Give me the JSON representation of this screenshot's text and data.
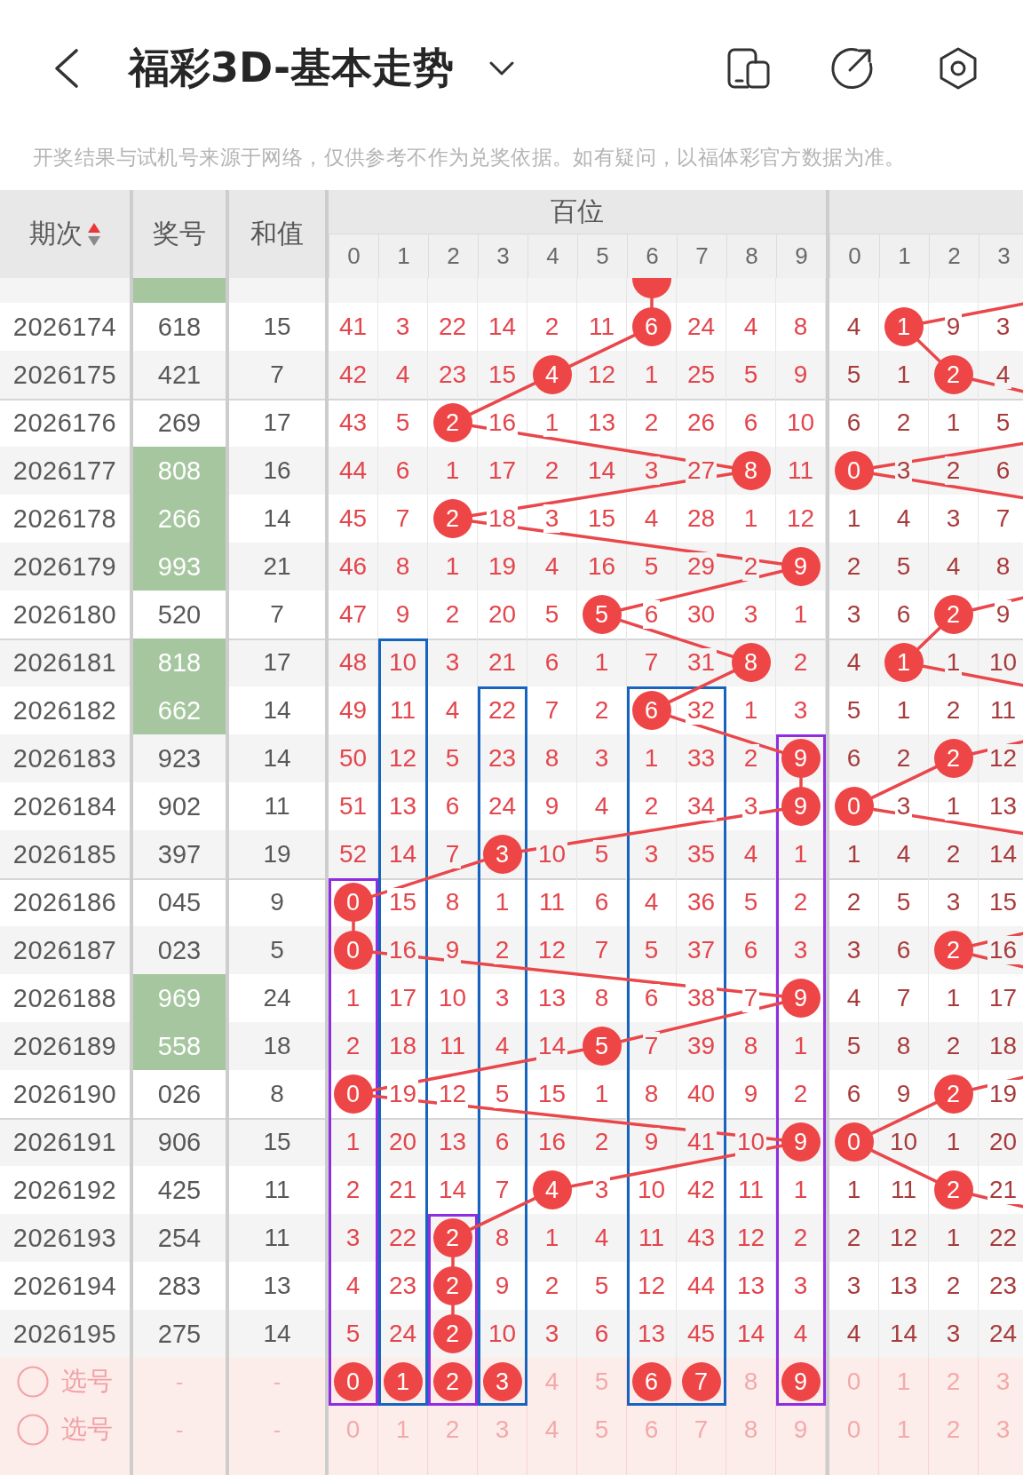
{
  "top_bar": {
    "title": "福彩3D-基本走势"
  },
  "notice": "开奖结果与试机号来源于网络，仅供参考不作为兑奖依据。如有疑问，以福体彩官方数据为准。",
  "table": {
    "issue_header": "期次",
    "sort_ascending": true,
    "number_header": "奖号",
    "sum_header": "和值",
    "hundreds_header": {
      "label": "百位",
      "digits": [
        "0",
        "1",
        "2",
        "3",
        "4",
        "5",
        "6",
        "7",
        "8",
        "9"
      ]
    },
    "group_2_header": {
      "digits": [
        "0",
        "1",
        "2",
        "3"
      ]
    },
    "cut_row": {
      "highlighted": true,
      "hundreds": [
        {
          "hit": false
        },
        {
          "hit": false
        },
        {
          "hit": false
        },
        {
          "hit": false
        },
        {
          "hit": false
        },
        {
          "hit": false
        },
        {
          "hit": true
        },
        {
          "hit": false
        },
        {
          "hit": false
        },
        {
          "hit": false
        }
      ]
    },
    "rows": [
      {
        "issue": "2026174",
        "number": "618",
        "sum": "15",
        "highlighted": false,
        "hundreds": [
          {
            "value": "41",
            "hit": false
          },
          {
            "value": "3",
            "hit": false
          },
          {
            "value": "22",
            "hit": false
          },
          {
            "value": "14",
            "hit": false
          },
          {
            "value": "2",
            "hit": false
          },
          {
            "value": "11",
            "hit": false
          },
          {
            "value": "6",
            "hit": true
          },
          {
            "value": "24",
            "hit": false
          },
          {
            "value": "4",
            "hit": false
          },
          {
            "value": "8",
            "hit": false
          }
        ],
        "group_2": [
          {
            "value": "4",
            "hit": false
          },
          {
            "value": "1",
            "hit": true
          },
          {
            "value": "9",
            "hit": false
          },
          {
            "value": "3",
            "hit": false
          }
        ]
      },
      {
        "issue": "2026175",
        "number": "421",
        "sum": "7",
        "highlighted": false,
        "hundreds": [
          {
            "value": "42",
            "hit": false
          },
          {
            "value": "4",
            "hit": false
          },
          {
            "value": "23",
            "hit": false
          },
          {
            "value": "15",
            "hit": false
          },
          {
            "value": "4",
            "hit": true
          },
          {
            "value": "12",
            "hit": false
          },
          {
            "value": "1",
            "hit": false
          },
          {
            "value": "25",
            "hit": false
          },
          {
            "value": "5",
            "hit": false
          },
          {
            "value": "9",
            "hit": false
          }
        ],
        "group_2": [
          {
            "value": "5",
            "hit": false
          },
          {
            "value": "1",
            "hit": false
          },
          {
            "value": "2",
            "hit": true
          },
          {
            "value": "4",
            "hit": false
          }
        ]
      },
      {
        "issue": "2026176",
        "number": "269",
        "sum": "17",
        "highlighted": false,
        "hundreds": [
          {
            "value": "43",
            "hit": false
          },
          {
            "value": "5",
            "hit": false
          },
          {
            "value": "2",
            "hit": true
          },
          {
            "value": "16",
            "hit": false
          },
          {
            "value": "1",
            "hit": false
          },
          {
            "value": "13",
            "hit": false
          },
          {
            "value": "2",
            "hit": false
          },
          {
            "value": "26",
            "hit": false
          },
          {
            "value": "6",
            "hit": false
          },
          {
            "value": "10",
            "hit": false
          }
        ],
        "group_2": [
          {
            "value": "6",
            "hit": false
          },
          {
            "value": "2",
            "hit": false
          },
          {
            "value": "1",
            "hit": false
          },
          {
            "value": "5",
            "hit": false
          }
        ]
      },
      {
        "issue": "2026177",
        "number": "808",
        "sum": "16",
        "highlighted": true,
        "hundreds": [
          {
            "value": "44",
            "hit": false
          },
          {
            "value": "6",
            "hit": false
          },
          {
            "value": "1",
            "hit": false
          },
          {
            "value": "17",
            "hit": false
          },
          {
            "value": "2",
            "hit": false
          },
          {
            "value": "14",
            "hit": false
          },
          {
            "value": "3",
            "hit": false
          },
          {
            "value": "27",
            "hit": false
          },
          {
            "value": "8",
            "hit": true
          },
          {
            "value": "11",
            "hit": false
          }
        ],
        "group_2": [
          {
            "value": "0",
            "hit": true
          },
          {
            "value": "3",
            "hit": false
          },
          {
            "value": "2",
            "hit": false
          },
          {
            "value": "6",
            "hit": false
          }
        ]
      },
      {
        "issue": "2026178",
        "number": "266",
        "sum": "14",
        "highlighted": true,
        "hundreds": [
          {
            "value": "45",
            "hit": false
          },
          {
            "value": "7",
            "hit": false
          },
          {
            "value": "2",
            "hit": true
          },
          {
            "value": "18",
            "hit": false
          },
          {
            "value": "3",
            "hit": false
          },
          {
            "value": "15",
            "hit": false
          },
          {
            "value": "4",
            "hit": false
          },
          {
            "value": "28",
            "hit": false
          },
          {
            "value": "1",
            "hit": false
          },
          {
            "value": "12",
            "hit": false
          }
        ],
        "group_2": [
          {
            "value": "1",
            "hit": false
          },
          {
            "value": "4",
            "hit": false
          },
          {
            "value": "3",
            "hit": false
          },
          {
            "value": "7",
            "hit": false
          }
        ]
      },
      {
        "issue": "2026179",
        "number": "993",
        "sum": "21",
        "highlighted": true,
        "hundreds": [
          {
            "value": "46",
            "hit": false
          },
          {
            "value": "8",
            "hit": false
          },
          {
            "value": "1",
            "hit": false
          },
          {
            "value": "19",
            "hit": false
          },
          {
            "value": "4",
            "hit": false
          },
          {
            "value": "16",
            "hit": false
          },
          {
            "value": "5",
            "hit": false
          },
          {
            "value": "29",
            "hit": false
          },
          {
            "value": "2",
            "hit": false
          },
          {
            "value": "9",
            "hit": true
          }
        ],
        "group_2": [
          {
            "value": "2",
            "hit": false
          },
          {
            "value": "5",
            "hit": false
          },
          {
            "value": "4",
            "hit": false
          },
          {
            "value": "8",
            "hit": false
          }
        ]
      },
      {
        "issue": "2026180",
        "number": "520",
        "sum": "7",
        "highlighted": false,
        "hundreds": [
          {
            "value": "47",
            "hit": false
          },
          {
            "value": "9",
            "hit": false
          },
          {
            "value": "2",
            "hit": false
          },
          {
            "value": "20",
            "hit": false
          },
          {
            "value": "5",
            "hit": false
          },
          {
            "value": "5",
            "hit": true
          },
          {
            "value": "6",
            "hit": false
          },
          {
            "value": "30",
            "hit": false
          },
          {
            "value": "3",
            "hit": false
          },
          {
            "value": "1",
            "hit": false
          }
        ],
        "group_2": [
          {
            "value": "3",
            "hit": false
          },
          {
            "value": "6",
            "hit": false
          },
          {
            "value": "2",
            "hit": true
          },
          {
            "value": "9",
            "hit": false
          }
        ]
      },
      {
        "issue": "2026181",
        "number": "818",
        "sum": "17",
        "highlighted": true,
        "hundreds": [
          {
            "value": "48",
            "hit": false
          },
          {
            "value": "10",
            "hit": false,
            "color": "#1565c0"
          },
          {
            "value": "3",
            "hit": false
          },
          {
            "value": "21",
            "hit": false
          },
          {
            "value": "6",
            "hit": false
          },
          {
            "value": "1",
            "hit": false
          },
          {
            "value": "7",
            "hit": false
          },
          {
            "value": "31",
            "hit": false
          },
          {
            "value": "8",
            "hit": true
          },
          {
            "value": "2",
            "hit": false
          }
        ],
        "group_2": [
          {
            "value": "4",
            "hit": false
          },
          {
            "value": "1",
            "hit": true
          },
          {
            "value": "1",
            "hit": false
          },
          {
            "value": "10",
            "hit": false
          }
        ]
      },
      {
        "issue": "2026182",
        "number": "662",
        "sum": "14",
        "highlighted": true,
        "hundreds": [
          {
            "value": "49",
            "hit": false
          },
          {
            "value": "11",
            "hit": false
          },
          {
            "value": "4",
            "hit": false
          },
          {
            "value": "22",
            "hit": false,
            "color": "#1565c0"
          },
          {
            "value": "7",
            "hit": false
          },
          {
            "value": "2",
            "hit": false
          },
          {
            "value": "6",
            "hit": true,
            "color": "#1565c0"
          },
          {
            "value": "32",
            "hit": false,
            "color": "#1565c0"
          },
          {
            "value": "1",
            "hit": false
          },
          {
            "value": "3",
            "hit": false
          }
        ],
        "group_2": [
          {
            "value": "5",
            "hit": false
          },
          {
            "value": "1",
            "hit": false
          },
          {
            "value": "2",
            "hit": false
          },
          {
            "value": "11",
            "hit": false
          }
        ]
      },
      {
        "issue": "2026183",
        "number": "923",
        "sum": "14",
        "highlighted": false,
        "hundreds": [
          {
            "value": "50",
            "hit": false
          },
          {
            "value": "12",
            "hit": false
          },
          {
            "value": "5",
            "hit": false
          },
          {
            "value": "23",
            "hit": false
          },
          {
            "value": "8",
            "hit": false
          },
          {
            "value": "3",
            "hit": false
          },
          {
            "value": "1",
            "hit": false
          },
          {
            "value": "33",
            "hit": false
          },
          {
            "value": "2",
            "hit": false
          },
          {
            "value": "9",
            "hit": true,
            "color": "#8e2de2"
          }
        ],
        "group_2": [
          {
            "value": "6",
            "hit": false
          },
          {
            "value": "2",
            "hit": false
          },
          {
            "value": "2",
            "hit": true
          },
          {
            "value": "12",
            "hit": false
          }
        ]
      },
      {
        "issue": "2026184",
        "number": "902",
        "sum": "11",
        "highlighted": false,
        "hundreds": [
          {
            "value": "51",
            "hit": false
          },
          {
            "value": "13",
            "hit": false
          },
          {
            "value": "6",
            "hit": false
          },
          {
            "value": "24",
            "hit": false
          },
          {
            "value": "9",
            "hit": false
          },
          {
            "value": "4",
            "hit": false
          },
          {
            "value": "2",
            "hit": false
          },
          {
            "value": "34",
            "hit": false
          },
          {
            "value": "3",
            "hit": false
          },
          {
            "value": "9",
            "hit": true
          }
        ],
        "group_2": [
          {
            "value": "0",
            "hit": true
          },
          {
            "value": "3",
            "hit": false
          },
          {
            "value": "1",
            "hit": false
          },
          {
            "value": "13",
            "hit": false
          }
        ]
      },
      {
        "issue": "2026185",
        "number": "397",
        "sum": "19",
        "highlighted": false,
        "hundreds": [
          {
            "value": "52",
            "hit": false
          },
          {
            "value": "14",
            "hit": false
          },
          {
            "value": "7",
            "hit": false
          },
          {
            "value": "3",
            "hit": true
          },
          {
            "value": "10",
            "hit": false
          },
          {
            "value": "5",
            "hit": false
          },
          {
            "value": "3",
            "hit": false
          },
          {
            "value": "35",
            "hit": false
          },
          {
            "value": "4",
            "hit": false
          },
          {
            "value": "1",
            "hit": false
          }
        ],
        "group_2": [
          {
            "value": "1",
            "hit": false
          },
          {
            "value": "4",
            "hit": false
          },
          {
            "value": "2",
            "hit": false
          },
          {
            "value": "14",
            "hit": false
          }
        ]
      },
      {
        "issue": "2026186",
        "number": "045",
        "sum": "9",
        "highlighted": false,
        "hundreds": [
          {
            "value": "0",
            "hit": true,
            "color": "#8e2de2"
          },
          {
            "value": "15",
            "hit": false
          },
          {
            "value": "8",
            "hit": false
          },
          {
            "value": "1",
            "hit": false
          },
          {
            "value": "11",
            "hit": false
          },
          {
            "value": "6",
            "hit": false
          },
          {
            "value": "4",
            "hit": false
          },
          {
            "value": "36",
            "hit": false
          },
          {
            "value": "5",
            "hit": false
          },
          {
            "value": "2",
            "hit": false
          }
        ],
        "group_2": [
          {
            "value": "2",
            "hit": false
          },
          {
            "value": "5",
            "hit": false
          },
          {
            "value": "3",
            "hit": false
          },
          {
            "value": "15",
            "hit": false
          }
        ]
      },
      {
        "issue": "2026187",
        "number": "023",
        "sum": "5",
        "highlighted": false,
        "hundreds": [
          {
            "value": "0",
            "hit": true
          },
          {
            "value": "16",
            "hit": false
          },
          {
            "value": "9",
            "hit": false
          },
          {
            "value": "2",
            "hit": false
          },
          {
            "value": "12",
            "hit": false
          },
          {
            "value": "7",
            "hit": false
          },
          {
            "value": "5",
            "hit": false
          },
          {
            "value": "37",
            "hit": false
          },
          {
            "value": "6",
            "hit": false
          },
          {
            "value": "3",
            "hit": false
          }
        ],
        "group_2": [
          {
            "value": "3",
            "hit": false
          },
          {
            "value": "6",
            "hit": false
          },
          {
            "value": "2",
            "hit": true
          },
          {
            "value": "16",
            "hit": false
          }
        ]
      },
      {
        "issue": "2026188",
        "number": "969",
        "sum": "24",
        "highlighted": true,
        "hundreds": [
          {
            "value": "1",
            "hit": false
          },
          {
            "value": "17",
            "hit": false
          },
          {
            "value": "10",
            "hit": false
          },
          {
            "value": "3",
            "hit": false
          },
          {
            "value": "13",
            "hit": false
          },
          {
            "value": "8",
            "hit": false
          },
          {
            "value": "6",
            "hit": false
          },
          {
            "value": "38",
            "hit": false
          },
          {
            "value": "7",
            "hit": false
          },
          {
            "value": "9",
            "hit": true
          }
        ],
        "group_2": [
          {
            "value": "4",
            "hit": false
          },
          {
            "value": "7",
            "hit": false
          },
          {
            "value": "1",
            "hit": false
          },
          {
            "value": "17",
            "hit": false
          }
        ]
      },
      {
        "issue": "2026189",
        "number": "558",
        "sum": "18",
        "highlighted": true,
        "hundreds": [
          {
            "value": "2",
            "hit": false
          },
          {
            "value": "18",
            "hit": false
          },
          {
            "value": "11",
            "hit": false
          },
          {
            "value": "4",
            "hit": false
          },
          {
            "value": "14",
            "hit": false
          },
          {
            "value": "5",
            "hit": true
          },
          {
            "value": "7",
            "hit": false
          },
          {
            "value": "39",
            "hit": false
          },
          {
            "value": "8",
            "hit": false
          },
          {
            "value": "1",
            "hit": false
          }
        ],
        "group_2": [
          {
            "value": "5",
            "hit": false
          },
          {
            "value": "8",
            "hit": false
          },
          {
            "value": "2",
            "hit": false
          },
          {
            "value": "18",
            "hit": false
          }
        ]
      },
      {
        "issue": "2026190",
        "number": "026",
        "sum": "8",
        "highlighted": false,
        "hundreds": [
          {
            "value": "0",
            "hit": true
          },
          {
            "value": "19",
            "hit": false
          },
          {
            "value": "12",
            "hit": false
          },
          {
            "value": "5",
            "hit": false
          },
          {
            "value": "15",
            "hit": false
          },
          {
            "value": "1",
            "hit": false
          },
          {
            "value": "8",
            "hit": false
          },
          {
            "value": "40",
            "hit": false
          },
          {
            "value": "9",
            "hit": false
          },
          {
            "value": "2",
            "hit": false
          }
        ],
        "group_2": [
          {
            "value": "6",
            "hit": false
          },
          {
            "value": "9",
            "hit": false
          },
          {
            "value": "2",
            "hit": true
          },
          {
            "value": "19",
            "hit": false
          }
        ]
      },
      {
        "issue": "2026191",
        "number": "906",
        "sum": "15",
        "highlighted": false,
        "hundreds": [
          {
            "value": "1",
            "hit": false
          },
          {
            "value": "20",
            "hit": false
          },
          {
            "value": "13",
            "hit": false
          },
          {
            "value": "6",
            "hit": false
          },
          {
            "value": "16",
            "hit": false
          },
          {
            "value": "2",
            "hit": false
          },
          {
            "value": "9",
            "hit": false
          },
          {
            "value": "41",
            "hit": false
          },
          {
            "value": "10",
            "hit": false
          },
          {
            "value": "9",
            "hit": true
          }
        ],
        "group_2": [
          {
            "value": "0",
            "hit": true
          },
          {
            "value": "10",
            "hit": false
          },
          {
            "value": "1",
            "hit": false
          },
          {
            "value": "20",
            "hit": false
          }
        ]
      },
      {
        "issue": "2026192",
        "number": "425",
        "sum": "11",
        "highlighted": false,
        "hundreds": [
          {
            "value": "2",
            "hit": false
          },
          {
            "value": "21",
            "hit": false
          },
          {
            "value": "14",
            "hit": false
          },
          {
            "value": "7",
            "hit": false
          },
          {
            "value": "4",
            "hit": true
          },
          {
            "value": "3",
            "hit": false
          },
          {
            "value": "10",
            "hit": false
          },
          {
            "value": "42",
            "hit": false
          },
          {
            "value": "11",
            "hit": false
          },
          {
            "value": "1",
            "hit": false
          }
        ],
        "group_2": [
          {
            "value": "1",
            "hit": false
          },
          {
            "value": "11",
            "hit": false
          },
          {
            "value": "2",
            "hit": true
          },
          {
            "value": "21",
            "hit": false
          }
        ]
      },
      {
        "issue": "2026193",
        "number": "254",
        "sum": "11",
        "highlighted": false,
        "hundreds": [
          {
            "value": "3",
            "hit": false
          },
          {
            "value": "22",
            "hit": false
          },
          {
            "value": "2",
            "hit": true,
            "color": "#8e2de2"
          },
          {
            "value": "8",
            "hit": false
          },
          {
            "value": "1",
            "hit": false
          },
          {
            "value": "4",
            "hit": false
          },
          {
            "value": "11",
            "hit": false
          },
          {
            "value": "43",
            "hit": false
          },
          {
            "value": "12",
            "hit": false
          },
          {
            "value": "2",
            "hit": false
          }
        ],
        "group_2": [
          {
            "value": "2",
            "hit": false
          },
          {
            "value": "12",
            "hit": false
          },
          {
            "value": "1",
            "hit": false
          },
          {
            "value": "22",
            "hit": false
          }
        ]
      },
      {
        "issue": "2026194",
        "number": "283",
        "sum": "13",
        "highlighted": false,
        "hundreds": [
          {
            "value": "4",
            "hit": false
          },
          {
            "value": "23",
            "hit": false
          },
          {
            "value": "2",
            "hit": true
          },
          {
            "value": "9",
            "hit": false
          },
          {
            "value": "2",
            "hit": false
          },
          {
            "value": "5",
            "hit": false
          },
          {
            "value": "12",
            "hit": false
          },
          {
            "value": "44",
            "hit": false
          },
          {
            "value": "13",
            "hit": false
          },
          {
            "value": "3",
            "hit": false
          }
        ],
        "group_2": [
          {
            "value": "3",
            "hit": false
          },
          {
            "value": "13",
            "hit": false
          },
          {
            "value": "2",
            "hit": false
          },
          {
            "value": "23",
            "hit": false
          }
        ]
      },
      {
        "issue": "2026195",
        "number": "275",
        "sum": "14",
        "highlighted": false,
        "hundreds": [
          {
            "value": "5",
            "hit": false
          },
          {
            "value": "24",
            "hit": false
          },
          {
            "value": "2",
            "hit": true
          },
          {
            "value": "10",
            "hit": false
          },
          {
            "value": "3",
            "hit": false
          },
          {
            "value": "6",
            "hit": false
          },
          {
            "value": "13",
            "hit": false
          },
          {
            "value": "45",
            "hit": false
          },
          {
            "value": "14",
            "hit": false
          },
          {
            "value": "4",
            "hit": false
          }
        ],
        "group_2": [
          {
            "value": "4",
            "hit": false
          },
          {
            "value": "14",
            "hit": false
          },
          {
            "value": "3",
            "hit": false
          },
          {
            "value": "24",
            "hit": false
          }
        ]
      }
    ],
    "pick_rows": [
      {
        "checked": false,
        "label": "选号",
        "number": "-",
        "sum": "-",
        "hundreds": [
          {
            "value": "0",
            "selected": true
          },
          {
            "value": "1",
            "selected": true
          },
          {
            "value": "2",
            "selected": true
          },
          {
            "value": "3",
            "selected": true
          },
          {
            "value": "4",
            "selected": false
          },
          {
            "value": "5",
            "selected": false
          },
          {
            "value": "6",
            "selected": true
          },
          {
            "value": "7",
            "selected": true
          },
          {
            "value": "8",
            "selected": false
          },
          {
            "value": "9",
            "selected": true
          }
        ],
        "group_2": [
          {
            "value": "0",
            "selected": false
          },
          {
            "value": "1",
            "selected": false
          },
          {
            "value": "2",
            "selected": false
          },
          {
            "value": "3",
            "selected": false
          }
        ]
      },
      {
        "checked": false,
        "label": "选号",
        "number": "-",
        "sum": "-",
        "hundreds": [
          {
            "value": "0",
            "selected": false
          },
          {
            "value": "1",
            "selected": false
          },
          {
            "value": "2",
            "selected": false
          },
          {
            "value": "3",
            "selected": false
          },
          {
            "value": "4",
            "selected": false
          },
          {
            "value": "5",
            "selected": false
          },
          {
            "value": "6",
            "selected": false
          },
          {
            "value": "7",
            "selected": false
          },
          {
            "value": "8",
            "selected": false
          },
          {
            "value": "9",
            "selected": false
          }
        ],
        "group_2": [
          {
            "value": "0",
            "selected": false
          },
          {
            "value": "1",
            "selected": false
          },
          {
            "value": "2",
            "selected": false
          },
          {
            "value": "3",
            "selected": false
          }
        ]
      }
    ]
  }
}
